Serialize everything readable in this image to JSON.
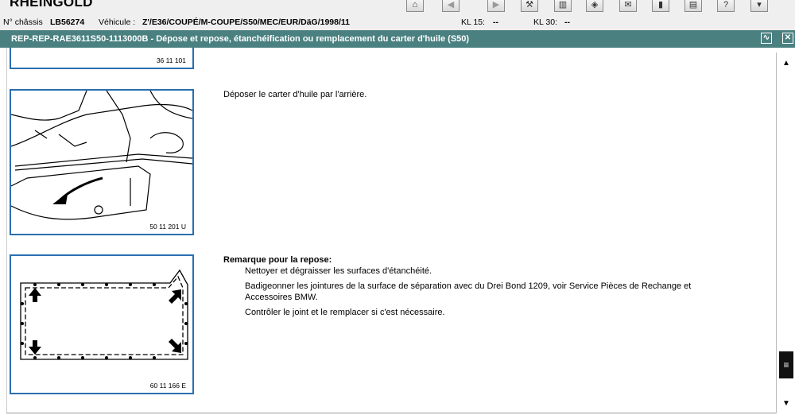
{
  "app": {
    "brand": "RHEINGOLD"
  },
  "info": {
    "chassis_label": "N° châssis",
    "chassis_value": "LB56274",
    "vehicle_label": "Véhicule :",
    "vehicle_value": "Z'/E36/COUPÉ/M-COUPE/S50/MEC/EUR/DäG/1998/11",
    "kl15_label": "KL 15:",
    "kl15_value": "--",
    "kl30_label": "KL 30:",
    "kl30_value": "--"
  },
  "toolbar": {
    "buttons": [
      {
        "name": "home-icon",
        "glyph": "⌂"
      },
      {
        "name": "back-icon",
        "glyph": "◀"
      },
      {
        "name": "forward-icon",
        "glyph": "▶"
      },
      {
        "name": "wrench-icon",
        "glyph": "🔧"
      },
      {
        "name": "book-icon",
        "glyph": "▥"
      },
      {
        "name": "diagnosis-icon",
        "glyph": "◈"
      },
      {
        "name": "mail-icon",
        "glyph": "✉"
      },
      {
        "name": "measure-icon",
        "glyph": "▮"
      },
      {
        "name": "print-icon",
        "glyph": "▤"
      },
      {
        "name": "help-icon",
        "glyph": "?"
      },
      {
        "name": "exit-icon",
        "glyph": "▾"
      }
    ]
  },
  "titlebar": {
    "title": "REP-REP-RAE3611S50-1113000B  -  Dépose et repose, étanchéification ou remplacement du carter d'huile (S50)"
  },
  "figures": [
    {
      "code": "36 11 101"
    },
    {
      "code": "50 11 201 U"
    },
    {
      "code": "60 11 166 E"
    }
  ],
  "steps": {
    "remove_text": "Déposer le carter d'huile par l'arrière.",
    "note_title": "Remarque pour la repose:",
    "note_items": [
      "Nettoyer et dégraisser les surfaces d'étanchéité.",
      "Badigeonner les jointures de la surface de séparation avec du Drei Bond 1209, voir Service Pièces de Rechange et Accessoires BMW.",
      "Contrôler le joint et le remplacer si c'est nécessaire."
    ]
  }
}
